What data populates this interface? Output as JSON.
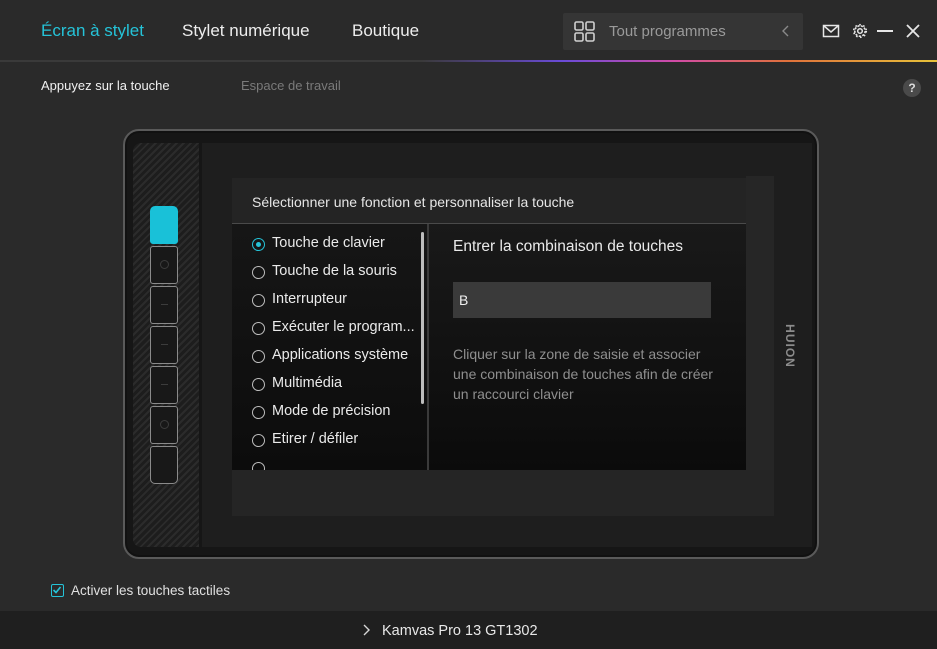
{
  "nav": {
    "tabs": [
      "Écran à stylet",
      "Stylet numérique",
      "Boutique"
    ],
    "active_index": 0,
    "accent_color": "#25c3d8"
  },
  "search": {
    "label": "Tout programmes",
    "icons": [
      "grid-icon",
      "chevron-left-icon"
    ]
  },
  "window_controls": [
    "mail-icon",
    "gear-icon",
    "minimize-icon",
    "close-icon"
  ],
  "subtabs": {
    "items": [
      "Appuyez sur la touche",
      "Espace de travail"
    ],
    "active_index": 0
  },
  "help_label": "?",
  "tablet": {
    "express_keys": {
      "count": 7,
      "active_index": 0
    },
    "brand": "HUION"
  },
  "panel": {
    "header": "Sélectionner une fonction et personnaliser la touche",
    "functions": [
      "Touche de clavier",
      "Touche de la souris",
      "Interrupteur",
      "Exécuter le program...",
      "Applications système",
      "Multimédia",
      "Mode de précision",
      "Etirer / défiler"
    ],
    "selected_index": 0,
    "detail": {
      "title": "Entrer la combinaison de touches",
      "input_value": "B",
      "help": "Cliquer sur la zone de saisie et associer une combinaison de touches afin de créer un raccourci clavier"
    }
  },
  "touch_toggle": {
    "label": "Activer les touches tactiles",
    "checked": true
  },
  "footer": {
    "device": "Kamvas Pro 13 GT1302"
  }
}
